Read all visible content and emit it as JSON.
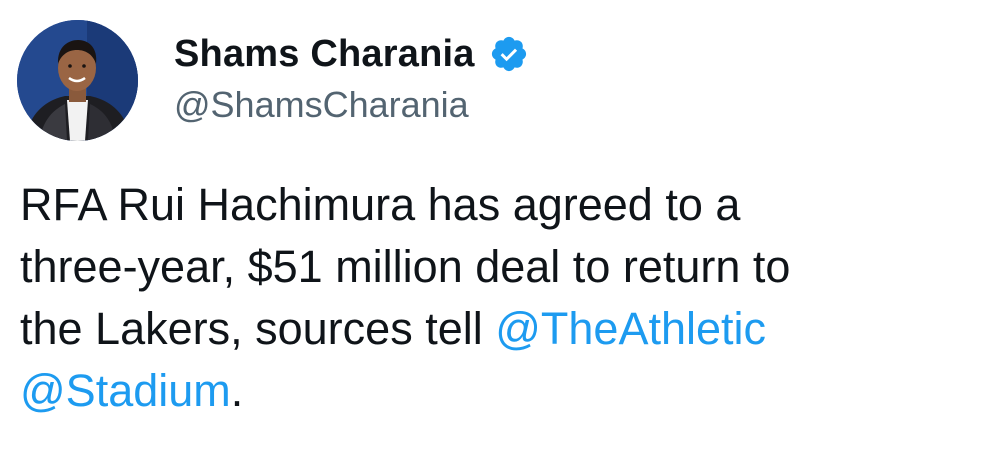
{
  "author": {
    "display_name": "Shams Charania",
    "handle": "@ShamsCharania",
    "verified": true,
    "verified_badge_color": "#1d9bf0"
  },
  "tweet": {
    "line1": "RFA Rui Hachimura has agreed to a",
    "line2": "three-year, $51 million deal to return to",
    "line3_text": "the Lakers, sources tell ",
    "mention1": "@TheAthletic",
    "mention2": "@Stadium",
    "trailing": "."
  },
  "colors": {
    "text": "#0f1419",
    "secondary_text": "#536471",
    "link": "#1d9bf0",
    "background": "#ffffff"
  },
  "icons": {
    "verified": "verified-badge-icon",
    "avatar": "profile-photo"
  }
}
